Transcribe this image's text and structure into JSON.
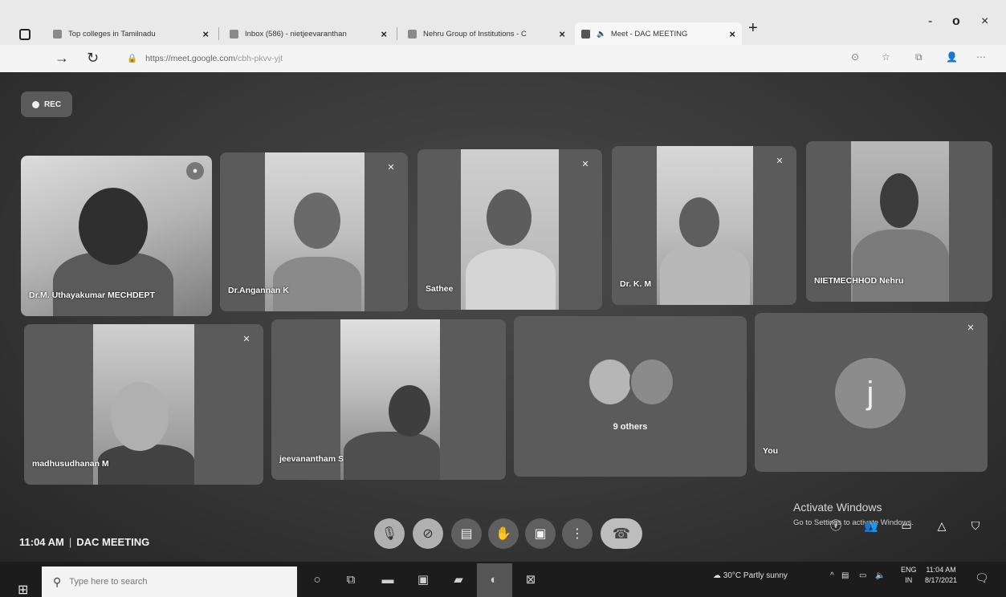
{
  "browser": {
    "tabs": [
      {
        "label": "Top colleges in Tamilnadu"
      },
      {
        "label": "Inbox (586) - nietjeevaranthan"
      },
      {
        "label": "Nehru Group of Institutions - C"
      },
      {
        "label": "Meet - DAC MEETING"
      }
    ],
    "close_glyph": "×",
    "new_tab_glyph": "+",
    "window_controls": {
      "minimize": "-",
      "maximize": "o",
      "close": "×"
    },
    "url_host": "https://meet.google.com",
    "url_path": "/cbh-pkvv-yjt"
  },
  "meet": {
    "rec_label": "REC",
    "participants": [
      {
        "name": "Dr.M. Uthayakumar MECHDEPT"
      },
      {
        "name": "Dr.Angannan K"
      },
      {
        "name": "Sathee"
      },
      {
        "name": "Dr. K. M"
      },
      {
        "name": "NIETMECHHOD Nehru"
      },
      {
        "name": "madhusudhanan M"
      },
      {
        "name": "jeevanantham S"
      },
      {
        "name": "You",
        "avatar_letter": "j"
      }
    ],
    "others_label": "9 others",
    "time": "11:04 AM",
    "divider": "|",
    "meeting_name": "DAC MEETING"
  },
  "watermark": {
    "title": "Activate Windows",
    "subtitle": "Go to Settings to activate Windows."
  },
  "taskbar": {
    "search_placeholder": "Type here to search",
    "weather": "30°C  Partly sunny",
    "lang_top": "ENG",
    "lang_bottom": "IN",
    "clock_time": "11:04 AM",
    "clock_date": "8/17/2021"
  },
  "icons": {
    "mic_off": "mic-off-icon",
    "camera_off": "camera-off-icon",
    "captions": "captions-icon",
    "raise_hand": "hand-icon",
    "present": "present-icon",
    "more": "more-icon",
    "end_call": "phone-end-icon"
  }
}
